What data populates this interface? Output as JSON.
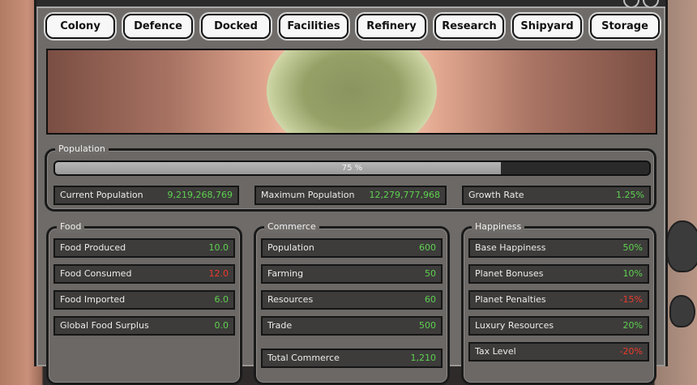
{
  "tabs": [
    "Colony",
    "Defence",
    "Docked",
    "Facilities",
    "Refinery",
    "Research",
    "Shipyard",
    "Storage"
  ],
  "population": {
    "title": "Population",
    "progress_fraction": 0.75,
    "progress_text": "75 %",
    "stats": [
      {
        "label": "Current Population",
        "value": "9,219,268,769"
      },
      {
        "label": "Maximum Population",
        "value": "12,279,777,968"
      },
      {
        "label": "Growth Rate",
        "value": "1.25%"
      }
    ]
  },
  "food": {
    "title": "Food",
    "rows": [
      {
        "label": "Food Produced",
        "value": "10.0",
        "tone": "green"
      },
      {
        "label": "Food Consumed",
        "value": "12.0",
        "tone": "red"
      },
      {
        "label": "Food Imported",
        "value": "6.0",
        "tone": "green"
      },
      {
        "label": "Global Food Surplus",
        "value": "0.0",
        "tone": "green"
      }
    ]
  },
  "commerce": {
    "title": "Commerce",
    "rows": [
      {
        "label": "Population",
        "value": "600",
        "tone": "green"
      },
      {
        "label": "Farming",
        "value": "50",
        "tone": "green"
      },
      {
        "label": "Resources",
        "value": "60",
        "tone": "green"
      },
      {
        "label": "Trade",
        "value": "500",
        "tone": "green"
      }
    ],
    "total": {
      "label": "Total Commerce",
      "value": "1,210",
      "tone": "green"
    }
  },
  "happiness": {
    "title": "Happiness",
    "rows": [
      {
        "label": "Base Happiness",
        "value": "50%",
        "tone": "green"
      },
      {
        "label": "Planet Bonuses",
        "value": "10%",
        "tone": "green"
      },
      {
        "label": "Planet Penalties",
        "value": "-15%",
        "tone": "red"
      },
      {
        "label": "Luxury Resources",
        "value": "20%",
        "tone": "green"
      },
      {
        "label": "Tax Level",
        "value": "-20%",
        "tone": "red"
      }
    ]
  },
  "colors": {
    "positive": "#5fd24f",
    "negative": "#ef3a2c"
  }
}
